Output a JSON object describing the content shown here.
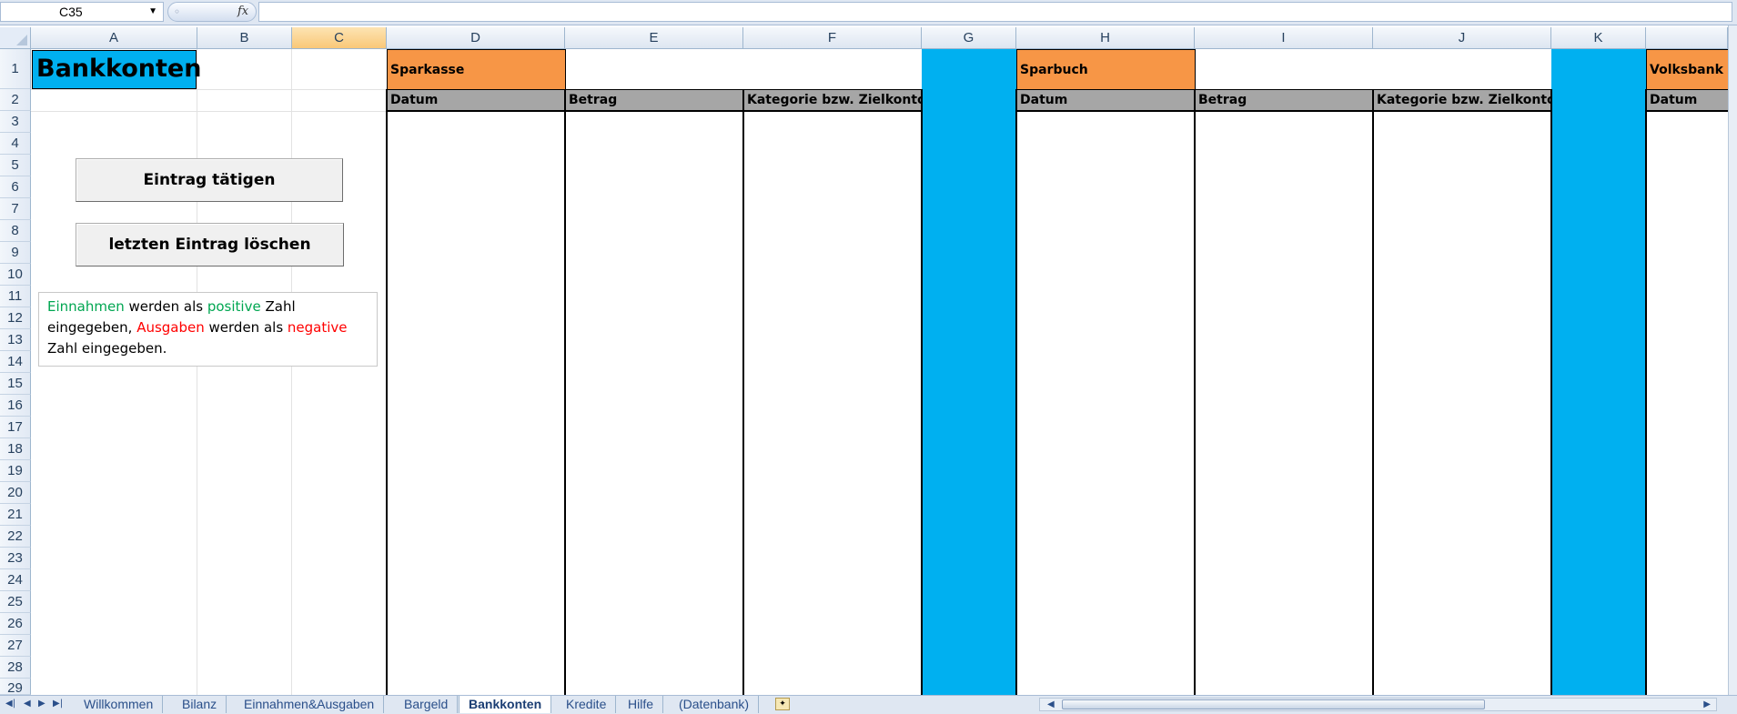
{
  "formula_bar": {
    "name_box": "C35",
    "fx_label": "fx",
    "formula": ""
  },
  "columns": [
    "A",
    "B",
    "C",
    "D",
    "E",
    "F",
    "G",
    "H",
    "I",
    "J",
    "K"
  ],
  "selected_column": "C",
  "rows": [
    "1",
    "2",
    "3",
    "4",
    "5",
    "6",
    "7",
    "8",
    "9",
    "10",
    "11",
    "12",
    "13",
    "14",
    "15",
    "16",
    "17",
    "18",
    "19",
    "20",
    "21",
    "22",
    "23",
    "24",
    "25",
    "26",
    "27",
    "28",
    "29"
  ],
  "sheet": {
    "title": "Bankkonten",
    "buttons": {
      "entry": "Eintrag tätigen",
      "delete_last": "letzten Eintrag löschen"
    },
    "note": {
      "p1": "Einnahmen",
      "p2": " werden als ",
      "p3": "positive",
      "p4": " Zahl eingegeben, ",
      "p5": "Ausgaben",
      "p6": " werden als ",
      "p7": "negative",
      "p8": " Zahl eingegeben."
    },
    "accounts": [
      {
        "name": "Sparkasse",
        "headers": [
          "Datum",
          "Betrag",
          "Kategorie bzw. Zielkonto"
        ]
      },
      {
        "name": "Sparbuch",
        "headers": [
          "Datum",
          "Betrag",
          "Kategorie bzw. Zielkonto"
        ]
      },
      {
        "name": "Volksbank",
        "headers": [
          "Datum"
        ]
      }
    ]
  },
  "colors": {
    "title_bg": "#00b0f0",
    "account_header": "#f79646",
    "column_header": "#a6a6a6",
    "separator": "#00b0f0"
  },
  "tabs": [
    "Willkommen",
    "Bilanz",
    "Einnahmen&Ausgaben",
    "Bargeld",
    "Bankkonten",
    "Kredite",
    "Hilfe",
    "(Datenbank)"
  ],
  "active_tab": "Bankkonten",
  "icons": {
    "nav_first": "◀|",
    "nav_prev": "◀",
    "nav_next": "▶",
    "nav_last": "▶|",
    "new_sheet": "new-sheet-icon"
  }
}
